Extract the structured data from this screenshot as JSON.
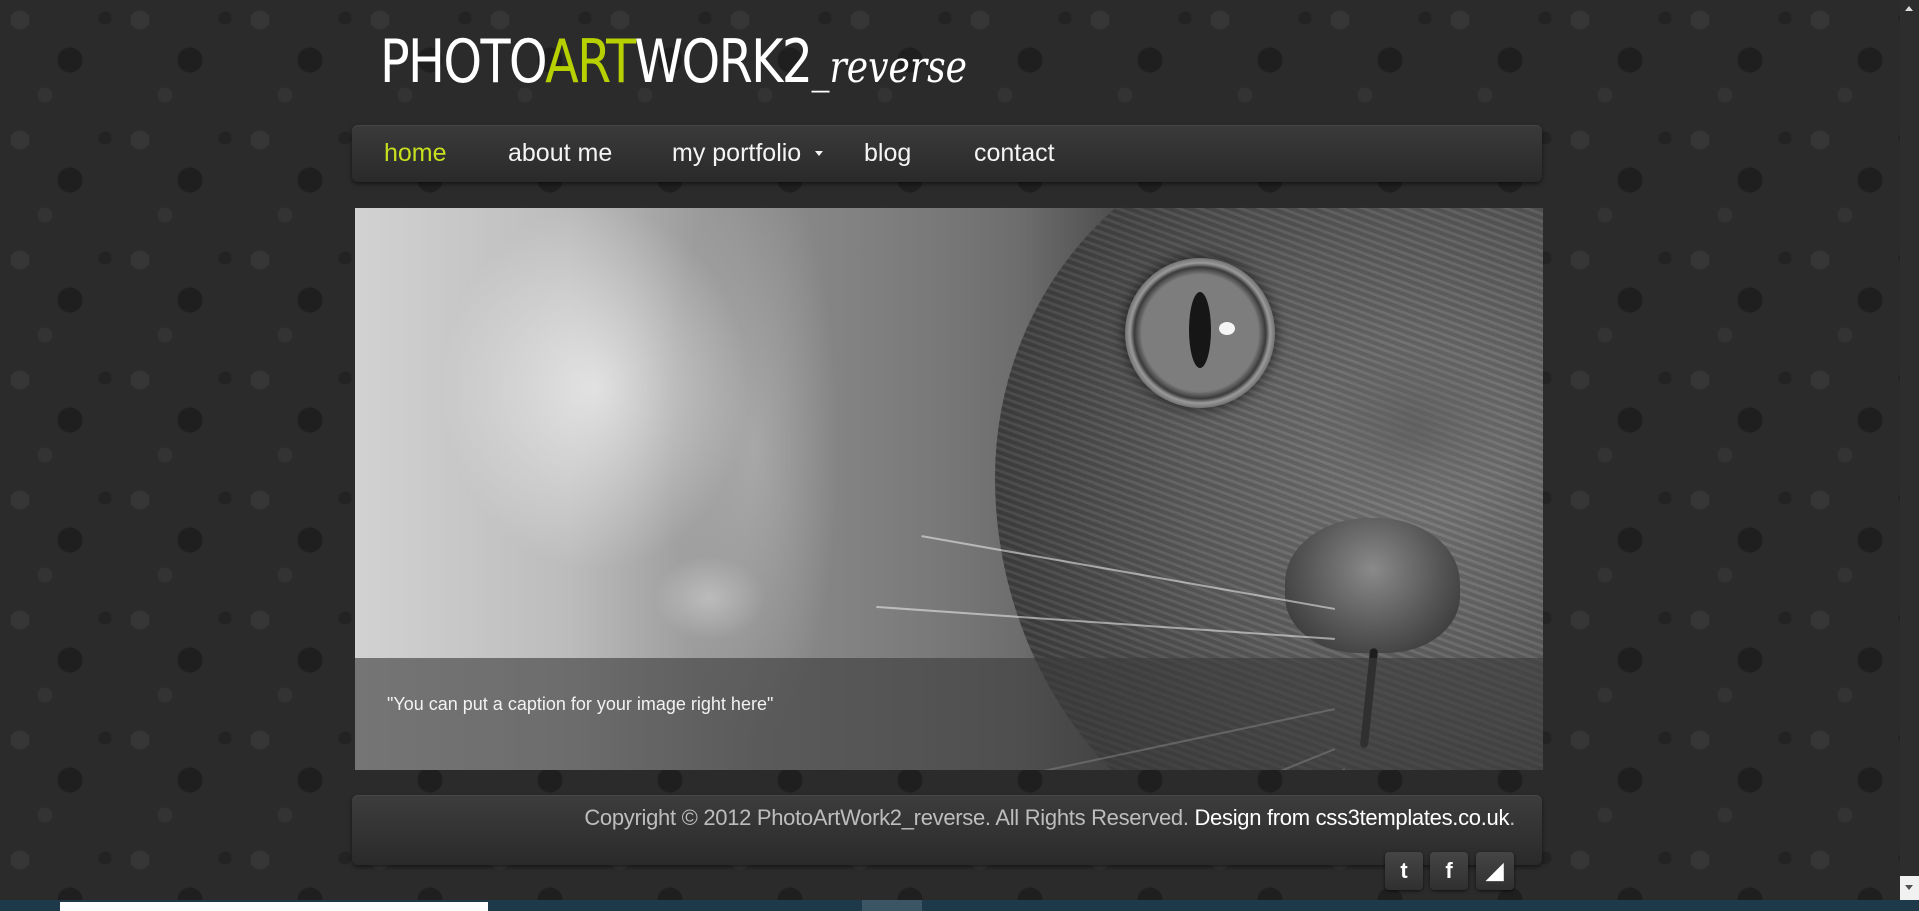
{
  "header": {
    "logo_part1": "PHOTO",
    "logo_accent": "ART",
    "logo_part2": "WORK2",
    "logo_suffix": "_reverse"
  },
  "nav": {
    "items": [
      {
        "label": "home",
        "active": true
      },
      {
        "label": "about me",
        "active": false
      },
      {
        "label": "my portfolio",
        "active": false,
        "has_dropdown": true
      },
      {
        "label": "blog",
        "active": false
      },
      {
        "label": "contact",
        "active": false
      }
    ]
  },
  "hero": {
    "caption": "\"You can put a caption for your image right here\""
  },
  "footer": {
    "copyright": "Copyright © 2012 PhotoArtWork2_reverse. All Rights Reserved. ",
    "design_link": "Design from css3templates.co.uk",
    "period": "."
  },
  "social": {
    "twitter_glyph": "t",
    "facebook_glyph": "f",
    "rss_glyph": "◢"
  },
  "icons": {
    "twitter": "twitter-icon",
    "facebook": "facebook-icon",
    "rss": "rss-icon",
    "dropdown": "caret-down-icon"
  },
  "colors": {
    "accent": "#c7df1e",
    "background": "#2b2b2b",
    "nav_text": "#f4f4f4"
  }
}
